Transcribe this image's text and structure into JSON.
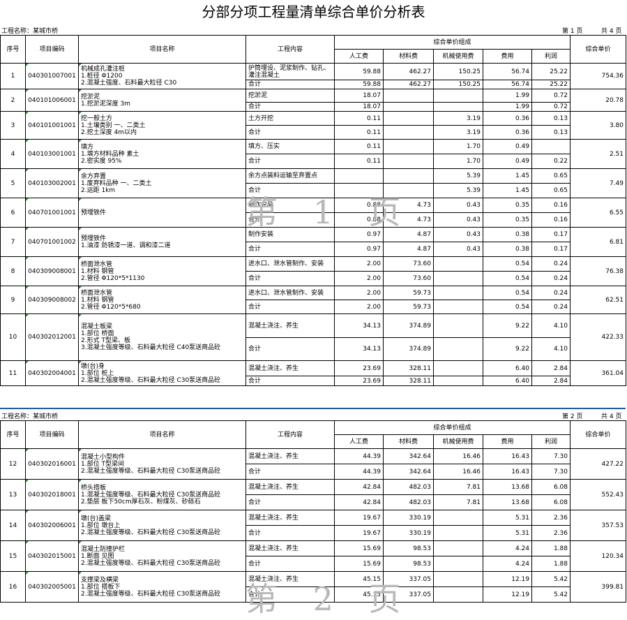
{
  "title": "分部分项工程量清单综合单价分析表",
  "project_label": "工程名称：某城市桥",
  "page1": {
    "page": "第 1 页",
    "total": "共 4 页"
  },
  "page2": {
    "page": "第 2 页",
    "total": "共 4 页"
  },
  "headers": {
    "seq": "序号",
    "code": "项目编码",
    "name": "项目名称",
    "work": "工程内容",
    "group": "综合单价组成",
    "labor": "人工费",
    "material": "材料费",
    "machine": "机械使用费",
    "fee": "费用",
    "profit": "利润",
    "unit": "综合单价"
  },
  "watermark1": "第 1 页",
  "watermark2": "第 2 页",
  "items1": [
    {
      "seq": "1",
      "code": "040301007001",
      "unit": "754.36",
      "name": [
        "机械成孔灌注桩",
        "1.桩径  Φ1200",
        "2.混凝土强度、石料最大粒径  C30"
      ],
      "rows": [
        {
          "work": "护筒埋设、泥浆制作、钻孔、灌注混凝土",
          "vals": [
            "59.88",
            "462.27",
            "150.25",
            "56.74",
            "25.22"
          ],
          "h": 24
        },
        {
          "work": "合计",
          "vals": [
            "59.88",
            "462.27",
            "150.25",
            "56.74",
            "25.22"
          ],
          "h": 13
        }
      ]
    },
    {
      "seq": "2",
      "code": "040101006001",
      "unit": "20.78",
      "name": [
        "挖淤泥",
        "1.挖淤泥深度  3m"
      ],
      "rows": [
        {
          "work": "挖淤泥",
          "vals": [
            "18.07",
            "",
            "",
            "1.99",
            "0.72"
          ],
          "h": 19
        },
        {
          "work": "合计",
          "vals": [
            "18.07",
            "",
            "",
            "1.99",
            "0.72"
          ],
          "h": 13
        }
      ]
    },
    {
      "seq": "3",
      "code": "040101001001",
      "unit": "3.80",
      "name": [
        "挖一般土方",
        "1.土壤类别  一、二类土",
        "2.挖土深度  4m以内"
      ],
      "rows": [
        {
          "work": "土方开挖",
          "vals": [
            "0.11",
            "",
            "3.19",
            "0.36",
            "0.13"
          ],
          "h": 20
        },
        {
          "work": "合计",
          "vals": [
            "0.11",
            "",
            "3.19",
            "0.36",
            "0.13"
          ],
          "h": 20
        }
      ]
    },
    {
      "seq": "4",
      "code": "040103001001",
      "unit": "2.51",
      "name": [
        "填方",
        "1.填方材料品种  素土",
        "2.密实度  95%"
      ],
      "rows": [
        {
          "work": "填方、压实",
          "vals": [
            "0.11",
            "",
            "1.70",
            "0.49",
            ""
          ],
          "h": 21
        },
        {
          "work": "合计",
          "vals": [
            "0.11",
            "",
            "1.70",
            "0.49",
            "0.22"
          ],
          "h": 21
        }
      ]
    },
    {
      "seq": "5",
      "code": "040103002001",
      "unit": "7.49",
      "name": [
        "余方弃置",
        "1.废弃料品种  一、二类土",
        "2.运距  1km"
      ],
      "rows": [
        {
          "work": "余方点装料运输至弃置点",
          "vals": [
            "",
            "",
            "5.39",
            "1.45",
            "0.65"
          ],
          "h": 21
        },
        {
          "work": "合计",
          "vals": [
            "",
            "",
            "5.39",
            "1.45",
            "0.65"
          ],
          "h": 21
        }
      ]
    },
    {
      "seq": "6",
      "code": "040701001001",
      "unit": "6.55",
      "name": [
        "预埋铁件"
      ],
      "rows": [
        {
          "work": "制作安装",
          "vals": [
            "0.88",
            "4.73",
            "0.43",
            "0.35",
            "0.16"
          ],
          "h": 21
        },
        {
          "work": "合计",
          "vals": [
            "0.88",
            "4.73",
            "0.43",
            "0.35",
            "0.16"
          ],
          "h": 21
        }
      ]
    },
    {
      "seq": "7",
      "code": "040701001002",
      "unit": "6.81",
      "name": [
        "预埋铁件",
        "1.油漆  防锈漆一道、调和漆二道"
      ],
      "rows": [
        {
          "work": "制作安装",
          "vals": [
            "0.97",
            "4.87",
            "0.43",
            "0.38",
            "0.17"
          ],
          "h": 21
        },
        {
          "work": "合计",
          "vals": [
            "0.97",
            "4.87",
            "0.43",
            "0.38",
            "0.17"
          ],
          "h": 21
        }
      ]
    },
    {
      "seq": "8",
      "code": "040309008001",
      "unit": "76.38",
      "name": [
        "桥面泄水管",
        "1.材料  钢管",
        "2.管径  Φ120*5*1130"
      ],
      "rows": [
        {
          "work": "进水口、泄水管制作、安装",
          "vals": [
            "2.00",
            "73.60",
            "",
            "0.54",
            "0.24"
          ],
          "h": 21
        },
        {
          "work": "合计",
          "vals": [
            "2.00",
            "73.60",
            "",
            "0.54",
            "0.24"
          ],
          "h": 21
        }
      ]
    },
    {
      "seq": "9",
      "code": "040309008002",
      "unit": "62.51",
      "name": [
        "桥面泄水管",
        "1.材料  钢管",
        "2.管径  Φ120*5*680"
      ],
      "rows": [
        {
          "work": "进水口、泄水管制作、安装",
          "vals": [
            "2.00",
            "59.73",
            "",
            "0.54",
            "0.24"
          ],
          "h": 20
        },
        {
          "work": "合计",
          "vals": [
            "2.00",
            "59.73",
            "",
            "0.54",
            "0.24"
          ],
          "h": 20
        }
      ]
    },
    {
      "seq": "10",
      "code": "040302012001",
      "unit": "422.33",
      "name": [
        "混凝土板梁",
        "1.部位  桥面",
        "2.形式  T型梁、板",
        "3.混凝土强度等级、石料最大粒径  C40泵送商品砼"
      ],
      "rows": [
        {
          "work": "混凝土浇注、养生",
          "vals": [
            "34.13",
            "374.89",
            "",
            "9.22",
            "4.10"
          ],
          "h": 34
        },
        {
          "work": "合计",
          "vals": [
            "34.13",
            "374.89",
            "",
            "9.22",
            "4.10"
          ],
          "h": 33
        }
      ]
    },
    {
      "seq": "11",
      "code": "040302004001",
      "unit": "361.04",
      "name": [
        "墩(台)身",
        "1.部位  桩上",
        "2.混凝土强度等级、石料最大粒径  C30泵送商品砼"
      ],
      "rows": [
        {
          "work": "混凝土浇注、养生",
          "vals": [
            "23.69",
            "328.11",
            "",
            "6.40",
            "2.84"
          ],
          "h": 22
        },
        {
          "work": "合计",
          "vals": [
            "23.69",
            "328.11",
            "",
            "6.40",
            "2.84"
          ],
          "h": 14
        }
      ]
    }
  ],
  "items2": [
    {
      "seq": "12",
      "code": "040302016001",
      "unit": "427.22",
      "name": [
        "混凝土小型构件",
        "1.部位  T型梁间",
        "2.混凝土强度等级、石料最大粒径  C30泵送商品砼"
      ],
      "rows": [
        {
          "work": "混凝土浇注、养生",
          "vals": [
            "44.39",
            "342.64",
            "16.46",
            "16.43",
            "7.30"
          ],
          "h": 22
        },
        {
          "work": "合计",
          "vals": [
            "44.39",
            "342.64",
            "16.46",
            "16.43",
            "7.30"
          ],
          "h": 22
        }
      ]
    },
    {
      "seq": "13",
      "code": "040302018001",
      "unit": "552.43",
      "name": [
        "桥头搭板",
        "1.混凝土强度等级、石料最大粒径  C30泵送商品砼",
        "2.垫层  板下50cm厚石灰、粉煤灰、砂砾石"
      ],
      "rows": [
        {
          "work": "混凝土浇注、养生",
          "vals": [
            "42.84",
            "482.03",
            "7.81",
            "13.68",
            "6.08"
          ],
          "h": 22
        },
        {
          "work": "合计",
          "vals": [
            "42.84",
            "482.03",
            "7.81",
            "13.68",
            "6.08"
          ],
          "h": 22
        }
      ]
    },
    {
      "seq": "14",
      "code": "040302006001",
      "unit": "357.53",
      "name": [
        "墩(台)盖梁",
        "1.部位  墩台上",
        "2.混凝土强度等级、石料最大粒径  C30泵送商品砼"
      ],
      "rows": [
        {
          "work": "混凝土浇注、养生",
          "vals": [
            "19.67",
            "330.19",
            "",
            "5.31",
            "2.36"
          ],
          "h": 22
        },
        {
          "work": "合计",
          "vals": [
            "19.67",
            "330.19",
            "",
            "5.31",
            "2.36"
          ],
          "h": 22
        }
      ]
    },
    {
      "seq": "15",
      "code": "040302015001",
      "unit": "120.34",
      "name": [
        "混凝土防撞护栏",
        "1.断面  见图",
        "2.混凝土强度等级、石料最大粒径  C30泵送商品砼"
      ],
      "rows": [
        {
          "work": "混凝土浇注、养生",
          "vals": [
            "15.69",
            "98.53",
            "",
            "4.24",
            "1.88"
          ],
          "h": 22
        },
        {
          "work": "合计",
          "vals": [
            "15.69",
            "98.53",
            "",
            "4.24",
            "1.88"
          ],
          "h": 22
        }
      ]
    },
    {
      "seq": "16",
      "code": "040302005001",
      "unit": "399.81",
      "name": [
        "支撑梁及横梁",
        "1.部位  搭板下",
        "2.混凝土强度等级、石料最大粒径  C30泵送商品砼"
      ],
      "rows": [
        {
          "work": "混凝土浇注、养生",
          "vals": [
            "45.15",
            "337.05",
            "",
            "12.19",
            "5.42"
          ],
          "h": 22
        },
        {
          "work": "合计",
          "vals": [
            "45.15",
            "337.05",
            "",
            "12.19",
            "5.42"
          ],
          "h": 22
        }
      ]
    }
  ]
}
